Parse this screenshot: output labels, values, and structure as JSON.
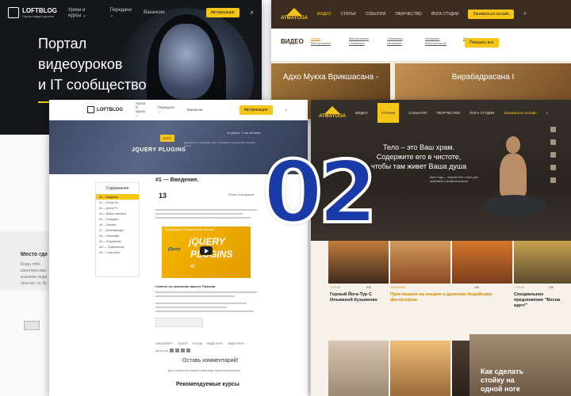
{
  "loftblog_top": {
    "logo": "LOFTBLOG",
    "logo_sub": "Портал видео-уроков",
    "nav": [
      "Уроки и курсы ⌄",
      "Передачи ⌄",
      "Вакансии"
    ],
    "auth_button": "Авторизация",
    "hero_title": "Портал\nвидеоуроков\nи IT сообщество",
    "place_title": "Место где",
    "place_sub": "Когда тебе заинтересова знанием люди опытом, ты бу"
  },
  "atmayoga_back": {
    "logo": "ATMAYOGA",
    "nav": [
      "ВИДЕО",
      "СТАТЬИ",
      "СОБЫТИЯ",
      "ТВОРЧЕСТВО",
      "ЙОГА СТУДИИ"
    ],
    "cta": "Заниматься онлайн",
    "section_title": "ВИДЕО",
    "filter_links": [
      "Асаны",
      "Выступления",
      "Семинары",
      "Интервью",
      "Мастерклассы",
      "Выступления",
      "Семинары",
      "Интервью",
      "Мастерклассы"
    ],
    "show_all": "Показать все",
    "tile_a": "Адхо Мукха Врикшасана -",
    "tile_b": "Вирабадрасана I"
  },
  "jquery_page": {
    "logo": "LOFTBLOG",
    "nav": [
      "Уроки и курсы ⌄",
      "Передачи ⌄",
      "Вакансии"
    ],
    "auth_button": "Авторизация",
    "badge": "КУРС",
    "title": "JQUERY PLUGINS",
    "stats": "16 уроков · 2 час 35 минут",
    "desc": "Данный курс познакомит вас с основами подключения плагинов jQuery",
    "toc_title": "Содержание",
    "toc_items": [
      "#1 — Введение.",
      "#2 — Обзор Plu...",
      "#3 — jQuery Pl...",
      "#4 — Выбор плагинов",
      "#5 — Слайдеры",
      "#6 — Галереи",
      "#7 — Всплывающие",
      "#8 — Навигация",
      "#9 — Популярные",
      "#10 — Подключение",
      "#11 — Настройки"
    ],
    "lesson_title": "#1 — Введение.",
    "date": "13",
    "author": "Роман Огородников",
    "video_caption": "Уроки jQuery: #1 Подключение плагинов",
    "video_jq1": "jQUERY",
    "video_jq2": "PLUGINS",
    "video_logo": "jQuery",
    "video_num": "#1",
    "advice_title": "Советы по освоению вашего Плагина",
    "tags": [
      "#JAVASCRIPT",
      "JQUERY",
      "PLUGIN",
      "ВИДЕОКУРС",
      "ВИДЕОУРОК"
    ],
    "share_label": "ДЕЛИТЬСЯ",
    "comment_title": "Оставь комментарий!",
    "login_text": "Для оставления комментария надо зарегистрироваться",
    "recommended": "Рекомендуемые курсы"
  },
  "atmayoga_front": {
    "logo": "ATMAYOGA",
    "nav": [
      "ВИДЕО",
      "СТАТЬИ",
      "СОБЫТИЯ",
      "ТВОРЧЕСТВО",
      "ЙОГА СТУДИИ"
    ],
    "cta": "Заниматься онлайн",
    "hero_title": "Тело – это Ваш храм.\nСодержите его в чистоте,\nчтобы там живет Ваша душа",
    "hero_desc": "Atma Yoga — первый блог о йоге для практиков и профессионалов.",
    "cards": [
      {
        "cat": "СТАТЬЯ",
        "count": "548",
        "title": "Горный Йога-Тур С Ильминой Кузьменко"
      },
      {
        "cat": "ПОЛЕЗНАЯ",
        "count": "348",
        "title": "Приглашаем на лекцию к древним Индийским философам"
      },
      {
        "cat": "СТАТЬЯ",
        "count": "348",
        "title": "Специальное предложение \"Весна идет!\""
      }
    ],
    "plate": "Как сделать\nстойку на\nодной ноге"
  },
  "badge_number": "02",
  "colors": {
    "accent_yellow": "#f5c518",
    "badge_blue": "#1a3aa8"
  }
}
